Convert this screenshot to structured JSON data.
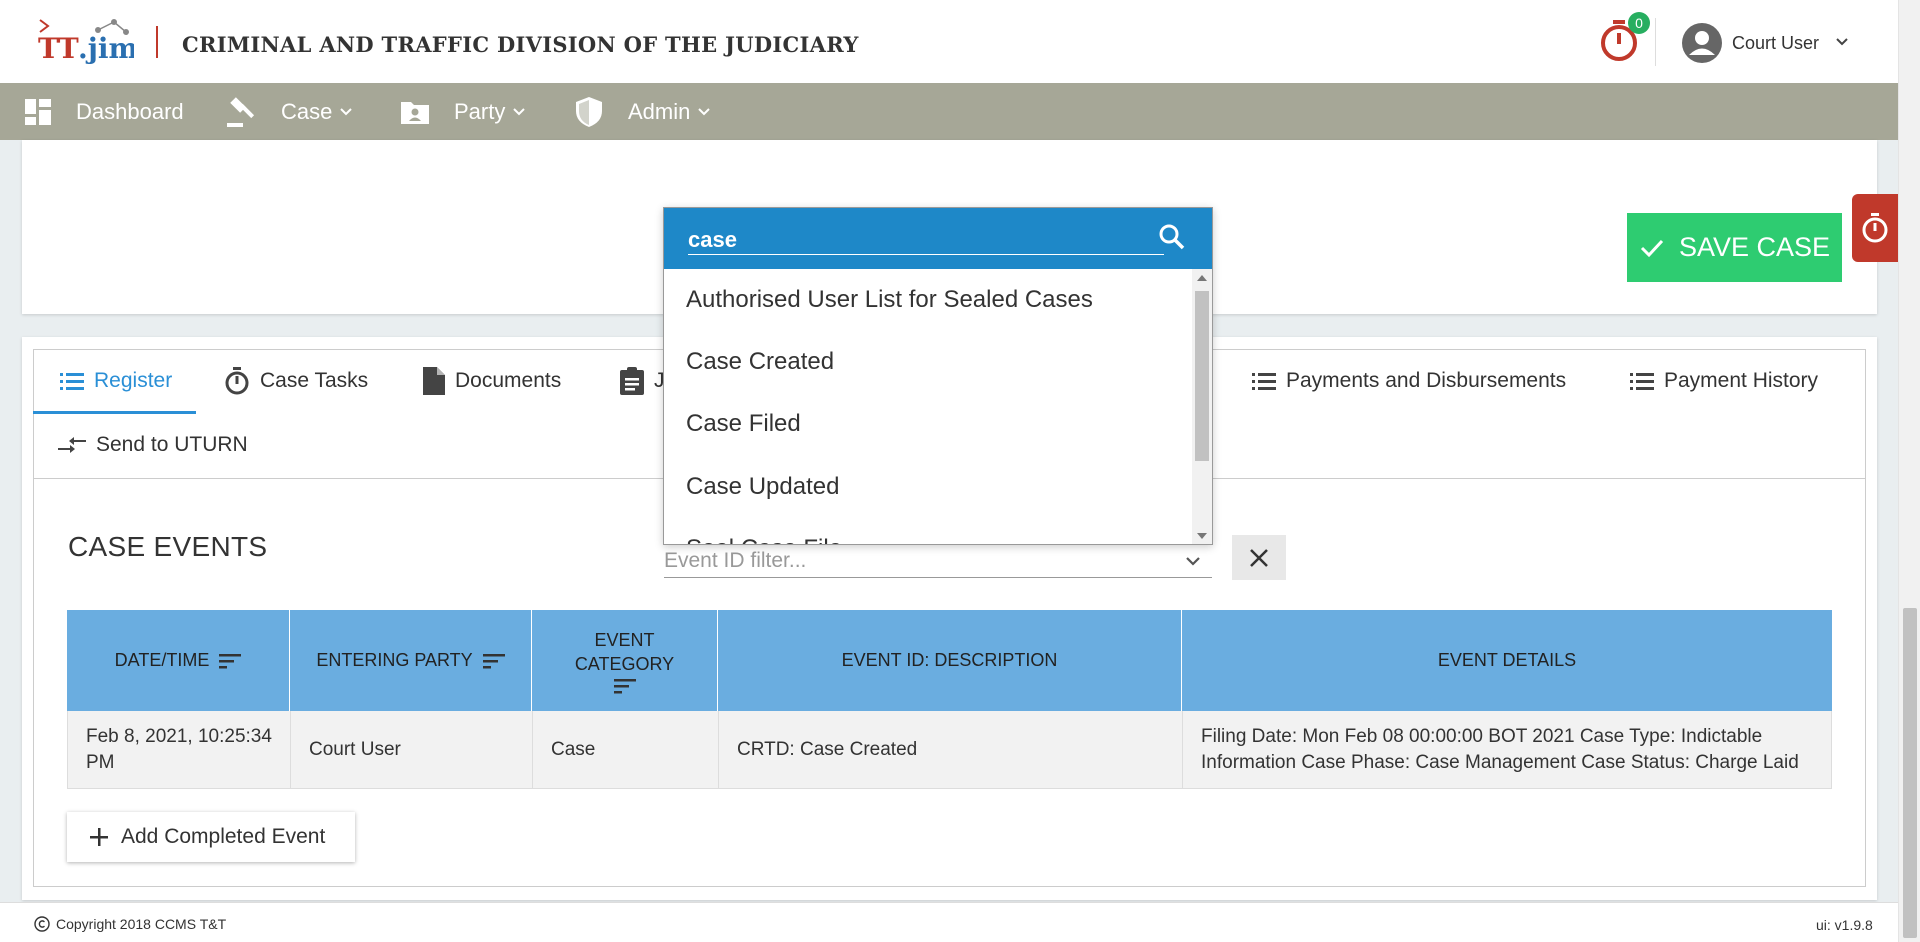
{
  "header": {
    "logo_text": "TT.jim",
    "app_title": "CRIMINAL AND TRAFFIC DIVISION OF THE JUDICIARY",
    "timer_count": "0",
    "user_name": "Court User"
  },
  "nav": {
    "items": [
      {
        "label": "Dashboard",
        "icon": "dashboard-icon"
      },
      {
        "label": "Case",
        "icon": "gavel-icon"
      },
      {
        "label": "Party",
        "icon": "contact-folder-icon"
      },
      {
        "label": "Admin",
        "icon": "shield-icon"
      }
    ]
  },
  "actions": {
    "save_label": "SAVE CASE"
  },
  "tabs": [
    {
      "label": "Register",
      "icon": "list-icon",
      "active": true
    },
    {
      "label": "Case Tasks",
      "icon": "timer-icon"
    },
    {
      "label": "Documents",
      "icon": "document-icon"
    },
    {
      "label": "J",
      "icon": "clipboard-icon"
    },
    {
      "label": "Payments and Disbursements",
      "icon": "list-icon"
    },
    {
      "label": "Payment History",
      "icon": "list-icon"
    },
    {
      "label": "Send to UTURN",
      "icon": "swap-icon"
    }
  ],
  "events": {
    "title": "CASE EVENTS",
    "filter_placeholder": "Event ID filter...",
    "columns": [
      "DATE/TIME",
      "ENTERING PARTY",
      "EVENT CATEGORY",
      "EVENT ID: DESCRIPTION",
      "EVENT DETAILS"
    ],
    "rows": [
      {
        "datetime": "Feb 8, 2021, 10:25:34 PM",
        "party": "Court User",
        "category": "Case",
        "description": "CRTD: Case Created",
        "details": "Filing Date: Mon Feb 08 00:00:00 BOT 2021 Case Type: Indictable Information Case Phase: Case Management Case Status: Charge Laid"
      }
    ],
    "add_label": "Add Completed Event"
  },
  "dropdown": {
    "search_value": "case",
    "options": [
      "Authorised User List for Sealed Cases",
      "Case Created",
      "Case Filed",
      "Case Updated",
      "Seal Case File"
    ]
  },
  "footer": {
    "copyright": "Copyright 2018  CCMS T&T",
    "version": "ui: v1.9.8"
  },
  "colors": {
    "nav_bg": "#a6a797",
    "accent": "#2a8fd6",
    "save_green": "#2ecc71",
    "table_header": "#6aade0",
    "dropdown_header": "#1e88c8",
    "timer_red": "#c0392b"
  }
}
